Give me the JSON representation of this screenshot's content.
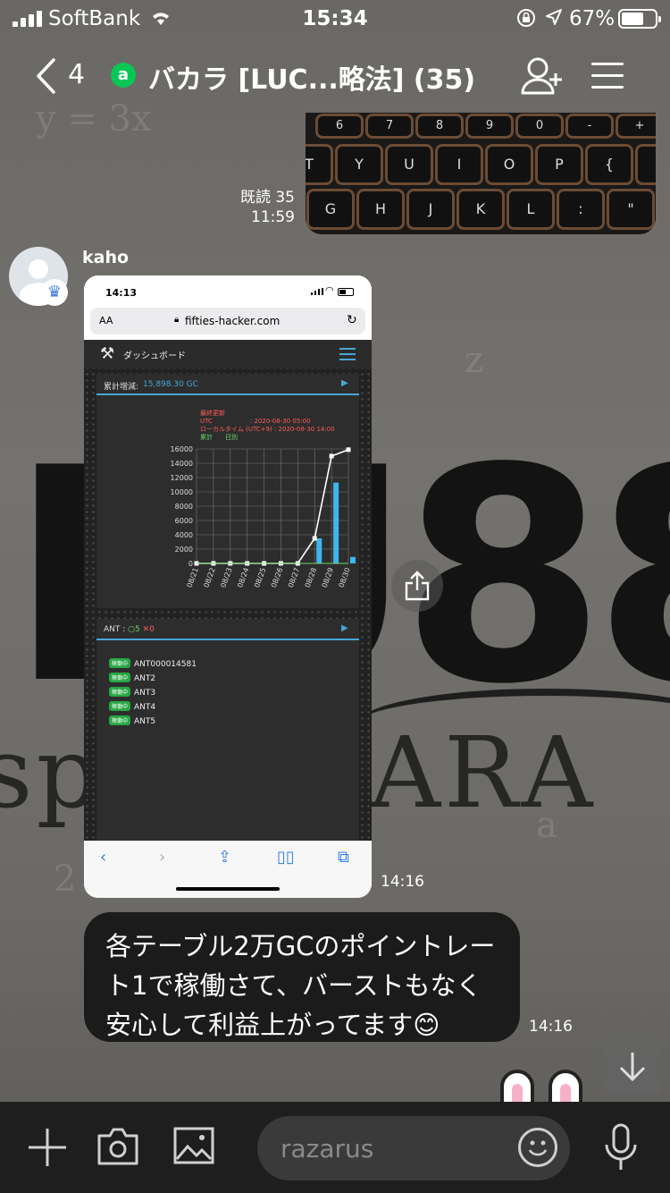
{
  "status_bar": {
    "carrier": "SoftBank",
    "time": "15:34",
    "battery_pct": "67%",
    "battery_level": 0.67
  },
  "header": {
    "back_count": "4",
    "group_badge": "a",
    "title": "バカラ [LUC...略法] (35)"
  },
  "sent_photo": {
    "keys_row1": [
      "6",
      "7",
      "8",
      "9",
      "0",
      "-",
      "+"
    ],
    "keys_row2": [
      "T",
      "Y",
      "U",
      "I",
      "O",
      "P",
      "{",
      "}"
    ],
    "keys_row3": [
      "G",
      "H",
      "J",
      "K",
      "L",
      ":",
      "\""
    ],
    "read_label": "既読 35",
    "time": "11:59"
  },
  "message": {
    "sender": "kaho",
    "screenshot": {
      "status_time": "14:13",
      "url_aa": "AA",
      "url": "fifties-hacker.com",
      "nav_title": "ダッシュボード",
      "card1_label": "累計増減:",
      "card1_value": "15,898.30 GC",
      "legend_title": "最終更新",
      "legend_utc": "UTC　　　　　　: 2020-08-30 05:00",
      "legend_local": "ローカルタイム (UTC+9) : 2020-08-30 14:00",
      "legend_series": "累計　　日別",
      "card2_label_prefix": "ANT : ",
      "card2_ok": "○5",
      "card2_ng": "✕0",
      "status_badge": "稼働中",
      "ants": [
        "ANT000014581",
        "ANT2",
        "ANT3",
        "ANT4",
        "ANT5"
      ]
    },
    "screenshot_time": "14:16",
    "text": "各テーブル2万GCのポイントレート1で稼働さて、バーストもなく安心して利益上がってます😊",
    "text_time": "14:16"
  },
  "chart_data": {
    "type": "line",
    "categories": [
      "08/21",
      "08/22",
      "08/23",
      "08/24",
      "08/25",
      "08/26",
      "08/27",
      "08/28",
      "08/29",
      "08/30"
    ],
    "series": [
      {
        "name": "累計",
        "values": [
          0,
          0,
          0,
          0,
          0,
          0,
          0,
          3500,
          15000,
          15898
        ],
        "color": "#ffffff"
      },
      {
        "name": "日別",
        "values": [
          0,
          0,
          0,
          0,
          0,
          0,
          0,
          3500,
          11300,
          900
        ],
        "color": "#3fb6ef"
      }
    ],
    "yticks": [
      "0",
      "2000",
      "4000",
      "6000",
      "8000",
      "10000",
      "12000",
      "14000",
      "16000"
    ],
    "ylim": [
      0,
      16000
    ],
    "grid": true
  },
  "input_bar": {
    "placeholder": "razarus"
  },
  "background": {
    "big_text": "LU88",
    "script_text": "sp ACCARA"
  }
}
